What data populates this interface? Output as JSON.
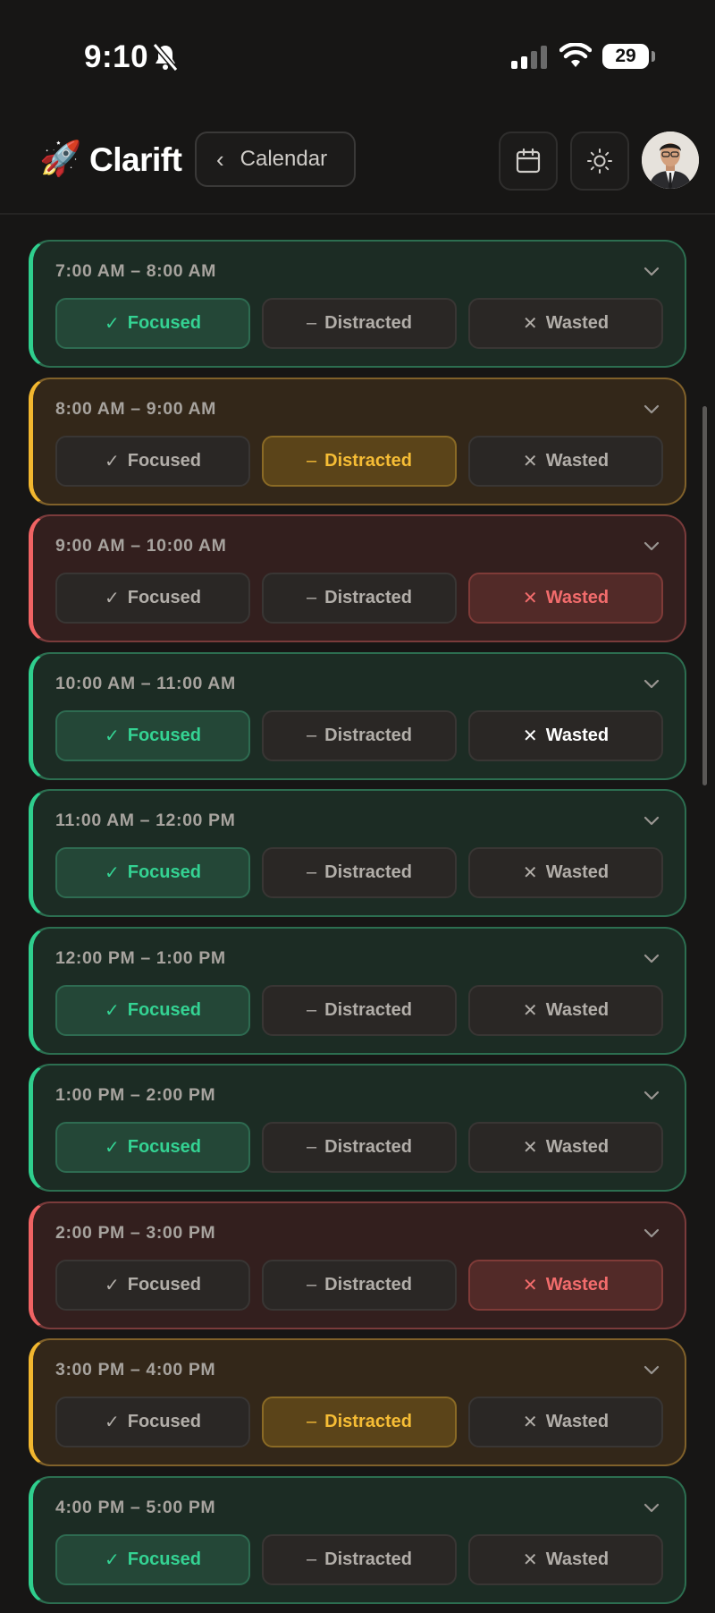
{
  "status_bar": {
    "time": "9:10",
    "battery": "29"
  },
  "header": {
    "brand": "Clarift",
    "logo_icon": "🚀",
    "back_label": "Calendar",
    "icons": [
      "calendar-icon",
      "sun-icon",
      "avatar"
    ]
  },
  "options": {
    "focused": "Focused",
    "distracted": "Distracted",
    "wasted": "Wasted",
    "glyphs": {
      "focused": "✓",
      "distracted": "–",
      "wasted": "✕"
    }
  },
  "colors": {
    "focused": "#2fcf8e",
    "distracted": "#f2b72f",
    "wasted": "#f06363",
    "background": "#171615"
  },
  "slots": [
    {
      "range": "7:00 AM – 8:00 AM",
      "status": "focused"
    },
    {
      "range": "8:00 AM – 9:00 AM",
      "status": "distracted"
    },
    {
      "range": "9:00 AM – 10:00 AM",
      "status": "wasted"
    },
    {
      "range": "10:00 AM – 11:00 AM",
      "status": "focused",
      "highlight": "wasted"
    },
    {
      "range": "11:00 AM – 12:00 PM",
      "status": "focused"
    },
    {
      "range": "12:00 PM – 1:00 PM",
      "status": "focused"
    },
    {
      "range": "1:00 PM – 2:00 PM",
      "status": "focused"
    },
    {
      "range": "2:00 PM – 3:00 PM",
      "status": "wasted"
    },
    {
      "range": "3:00 PM – 4:00 PM",
      "status": "distracted"
    },
    {
      "range": "4:00 PM – 5:00 PM",
      "status": "focused"
    }
  ]
}
